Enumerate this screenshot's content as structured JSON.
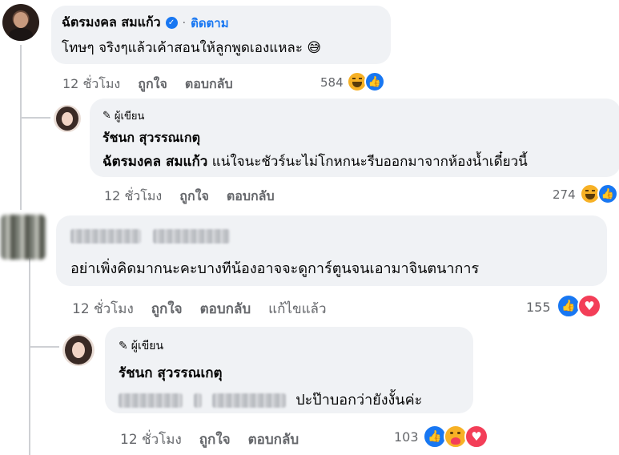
{
  "comments": [
    {
      "author": "ฉัตรมงคล สมแก้ว",
      "follow": "ติดตาม",
      "separator": "·",
      "text": "โทษๆ จริงๆแล้วเค้าสอนให้ลูกพูดเองแหละ 😅",
      "time": "12 ชั่วโมง",
      "like": "ถูกใจ",
      "reply": "ตอบกลับ",
      "count": "584",
      "reactions": [
        "haha-icon",
        "like-icon"
      ]
    },
    {
      "badge": "ผู้เขียน",
      "author": "รัชนก สุวรรณเกตุ",
      "mention": "ฉัตรมงคล สมแก้ว",
      "text": "แน่ใจนะชัวร์นะไม่โกหกนะรีบออกมาจากห้องน้ำเดี๋ยวนี้",
      "time": "12 ชั่วโมง",
      "like": "ถูกใจ",
      "reply": "ตอบกลับ",
      "count": "274",
      "reactions": [
        "haha-icon",
        "like-icon"
      ]
    },
    {
      "text": "อย่าเพิ่งคิดมากนะคะบางทีน้องอาจจะดูการ์ตูนจนเอามาจินตนาการ",
      "time": "12 ชั่วโมง",
      "like": "ถูกใจ",
      "reply": "ตอบกลับ",
      "edited": "แก้ไขแล้ว",
      "count": "155",
      "reactions": [
        "like-icon",
        "love-icon"
      ]
    },
    {
      "badge": "ผู้เขียน",
      "author": "รัชนก สุวรรณเกตุ",
      "text": "ปะป๊าบอกว่ายังงั้นค่ะ",
      "time": "12 ชั่วโมง",
      "like": "ถูกใจ",
      "reply": "ตอบกลับ",
      "count": "103",
      "reactions": [
        "like-icon",
        "care-icon",
        "love-icon"
      ]
    }
  ],
  "colors": {
    "like": "#1877f2",
    "love": "#f33e58",
    "haha": "#f7b125",
    "bubble": "#f0f2f5",
    "meta": "#65676b",
    "verified": "#1877f2",
    "follow": "#1877f2"
  }
}
